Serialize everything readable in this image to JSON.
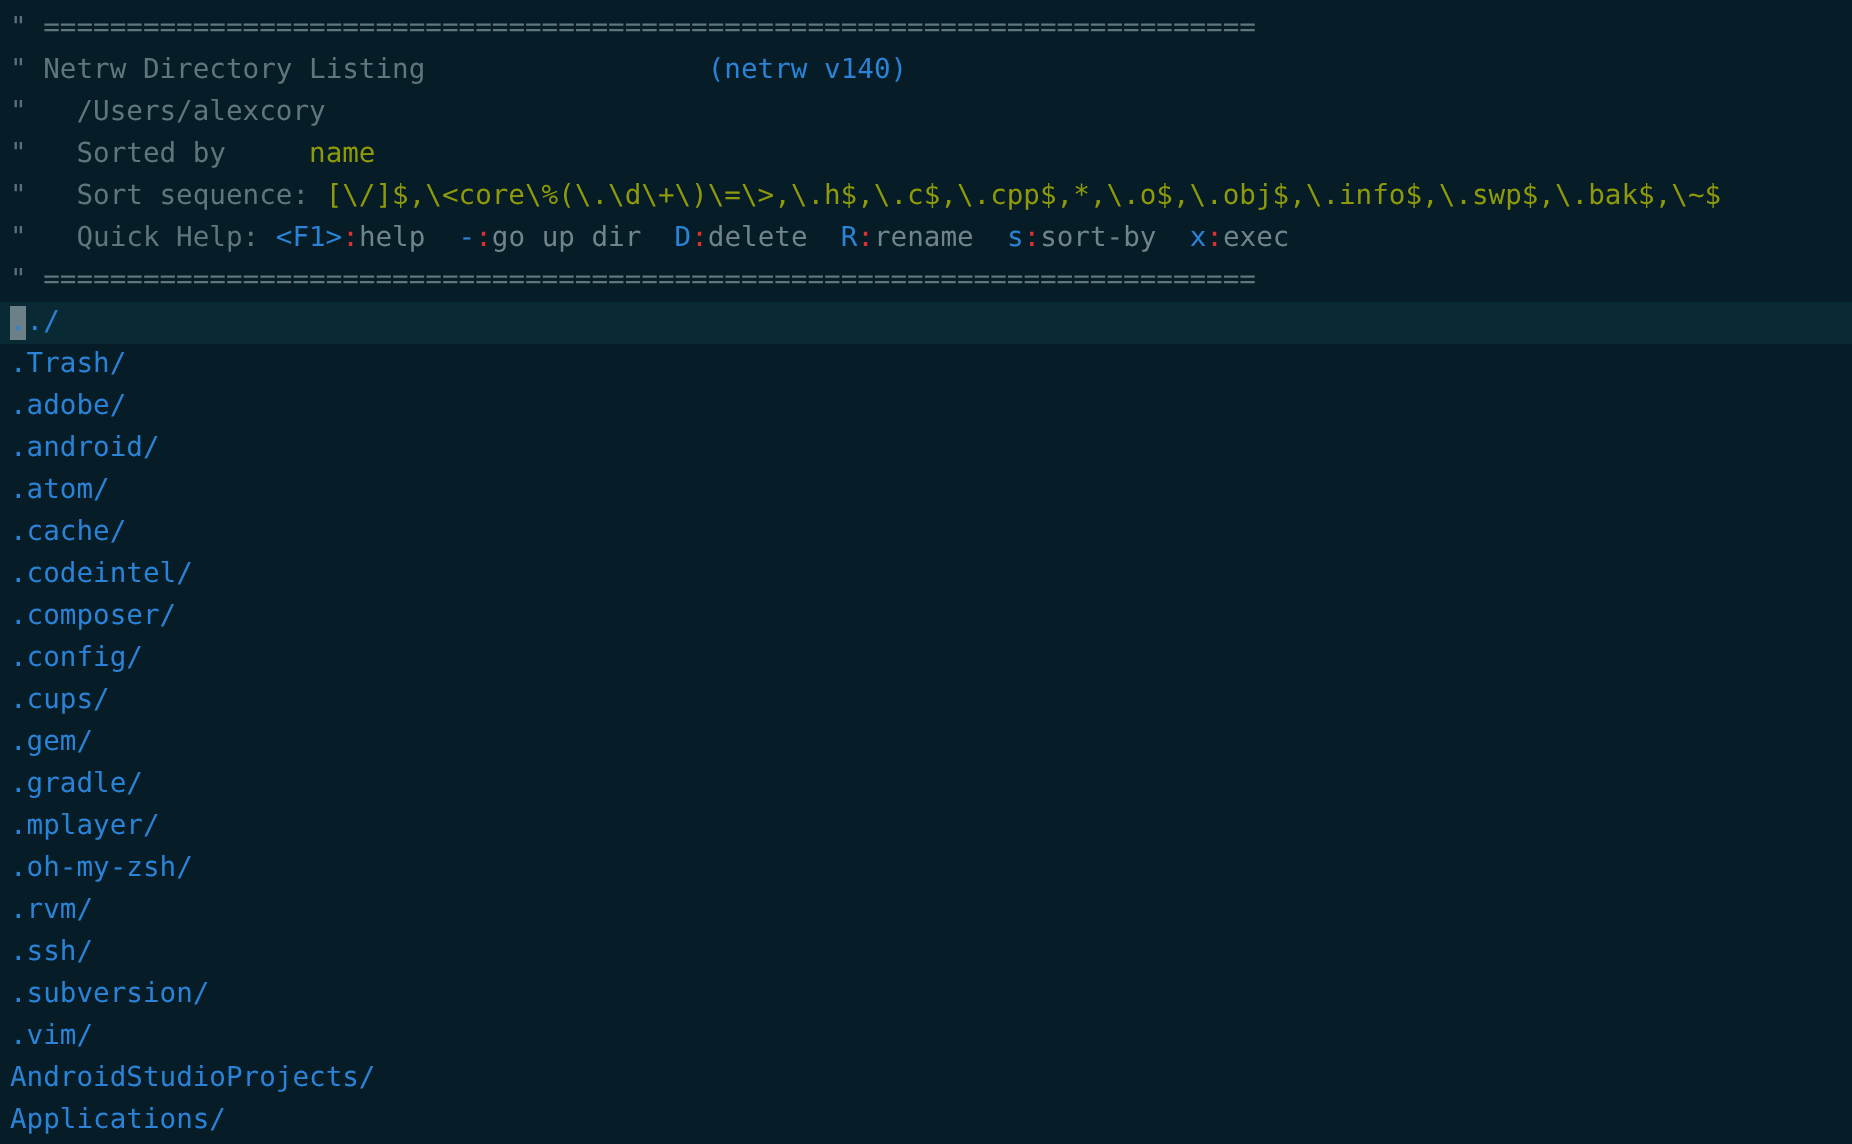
{
  "header": {
    "lines": [
      {
        "kind": "rule",
        "mark": "\"",
        "text": "========================================================================="
      },
      {
        "kind": "title",
        "mark": "\"",
        "text": "Netrw Directory Listing",
        "version": "(netrw v140)"
      },
      {
        "kind": "path",
        "mark": "\"",
        "text": "/Users/alexcory"
      },
      {
        "kind": "setting",
        "mark": "\"",
        "label": "Sorted by",
        "value": "name"
      },
      {
        "kind": "setting",
        "mark": "\"",
        "label": "Sort sequence:",
        "value": "[\\/]$,\\<core\\%(\\.\\d\\+\\)\\=\\>,\\.h$,\\.c$,\\.cpp$,*,\\.o$,\\.obj$,\\.info$,\\.swp$,\\.bak$,\\~$"
      },
      {
        "kind": "help",
        "mark": "\"",
        "label": "Quick Help:",
        "items": [
          {
            "key": "<F1>",
            "sep": ":",
            "action": "help"
          },
          {
            "key": "-",
            "sep": ":",
            "action": "go up dir"
          },
          {
            "key": "D",
            "sep": ":",
            "action": "delete"
          },
          {
            "key": "R",
            "sep": ":",
            "action": "rename"
          },
          {
            "key": "s",
            "sep": ":",
            "action": "sort-by"
          },
          {
            "key": "x",
            "sep": ":",
            "action": "exec"
          }
        ]
      },
      {
        "kind": "rule",
        "mark": "\"",
        "text": "========================================================================="
      }
    ]
  },
  "entries": [
    {
      "name": "../",
      "selected": true
    },
    {
      "name": ".Trash/",
      "selected": false
    },
    {
      "name": ".adobe/",
      "selected": false
    },
    {
      "name": ".android/",
      "selected": false
    },
    {
      "name": ".atom/",
      "selected": false
    },
    {
      "name": ".cache/",
      "selected": false
    },
    {
      "name": ".codeintel/",
      "selected": false
    },
    {
      "name": ".composer/",
      "selected": false
    },
    {
      "name": ".config/",
      "selected": false
    },
    {
      "name": ".cups/",
      "selected": false
    },
    {
      "name": ".gem/",
      "selected": false
    },
    {
      "name": ".gradle/",
      "selected": false
    },
    {
      "name": ".mplayer/",
      "selected": false
    },
    {
      "name": ".oh-my-zsh/",
      "selected": false
    },
    {
      "name": ".rvm/",
      "selected": false
    },
    {
      "name": ".ssh/",
      "selected": false
    },
    {
      "name": ".subversion/",
      "selected": false
    },
    {
      "name": ".vim/",
      "selected": false
    },
    {
      "name": "AndroidStudioProjects/",
      "selected": false
    },
    {
      "name": "Applications/",
      "selected": false
    }
  ]
}
